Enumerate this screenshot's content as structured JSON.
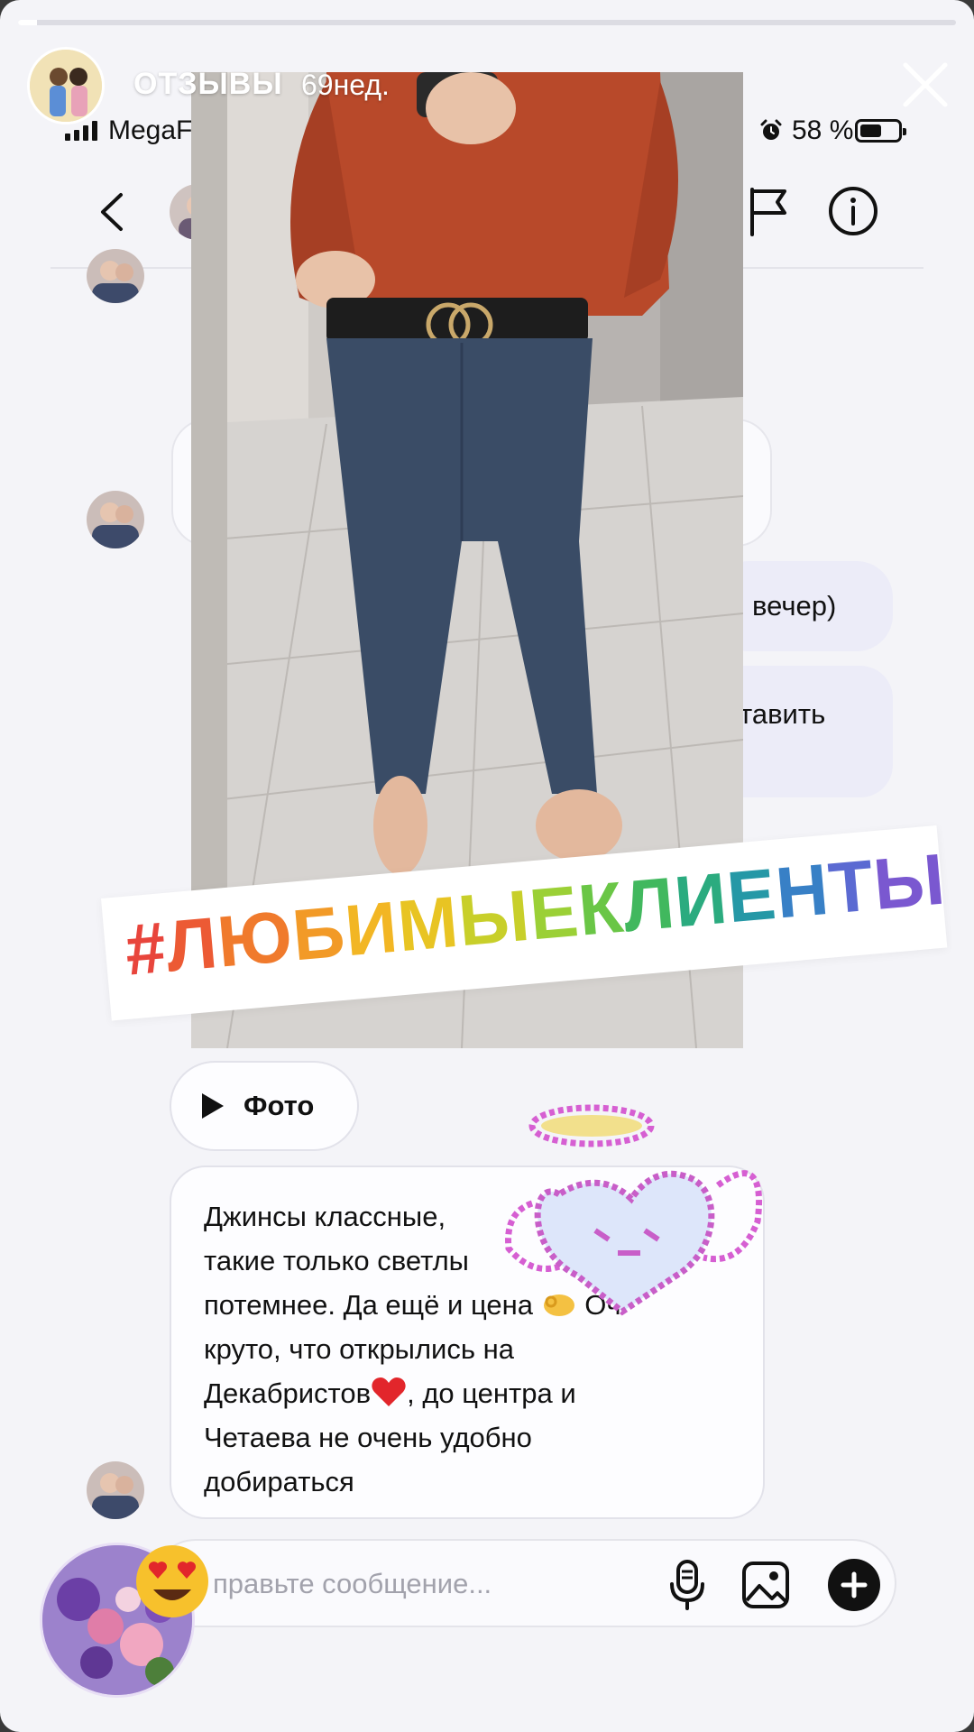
{
  "story": {
    "progress": 0.02,
    "title": "ОТЗЫВЫ",
    "time": "69нед."
  },
  "status_bar": {
    "carrier": "MegaF",
    "battery": "58 %"
  },
  "chat": {
    "bubble_evening": "вечер)",
    "bubble_leave": "тавить",
    "photo_label": "Фото",
    "review_lines": [
      "Джинсы классные,",
      "такие только светлы",
      "потемнее. Да ещё и цена",
      "Оч",
      "круто, что открылись на",
      "Декабристов",
      ", до центра и",
      "Четаева не очень удобно",
      "добираться"
    ],
    "composer_placeholder": "правьте сообщение..."
  },
  "overlay": {
    "hashtag": "#ЛЮБИМЫЕКЛИЕНТЫ"
  },
  "icons": {
    "close": "close-icon",
    "back": "chevron-left-icon",
    "flag": "flag-icon",
    "info": "info-icon",
    "mic": "microphone-icon",
    "gallery": "image-icon",
    "plus": "plus-icon",
    "play": "play-icon"
  }
}
